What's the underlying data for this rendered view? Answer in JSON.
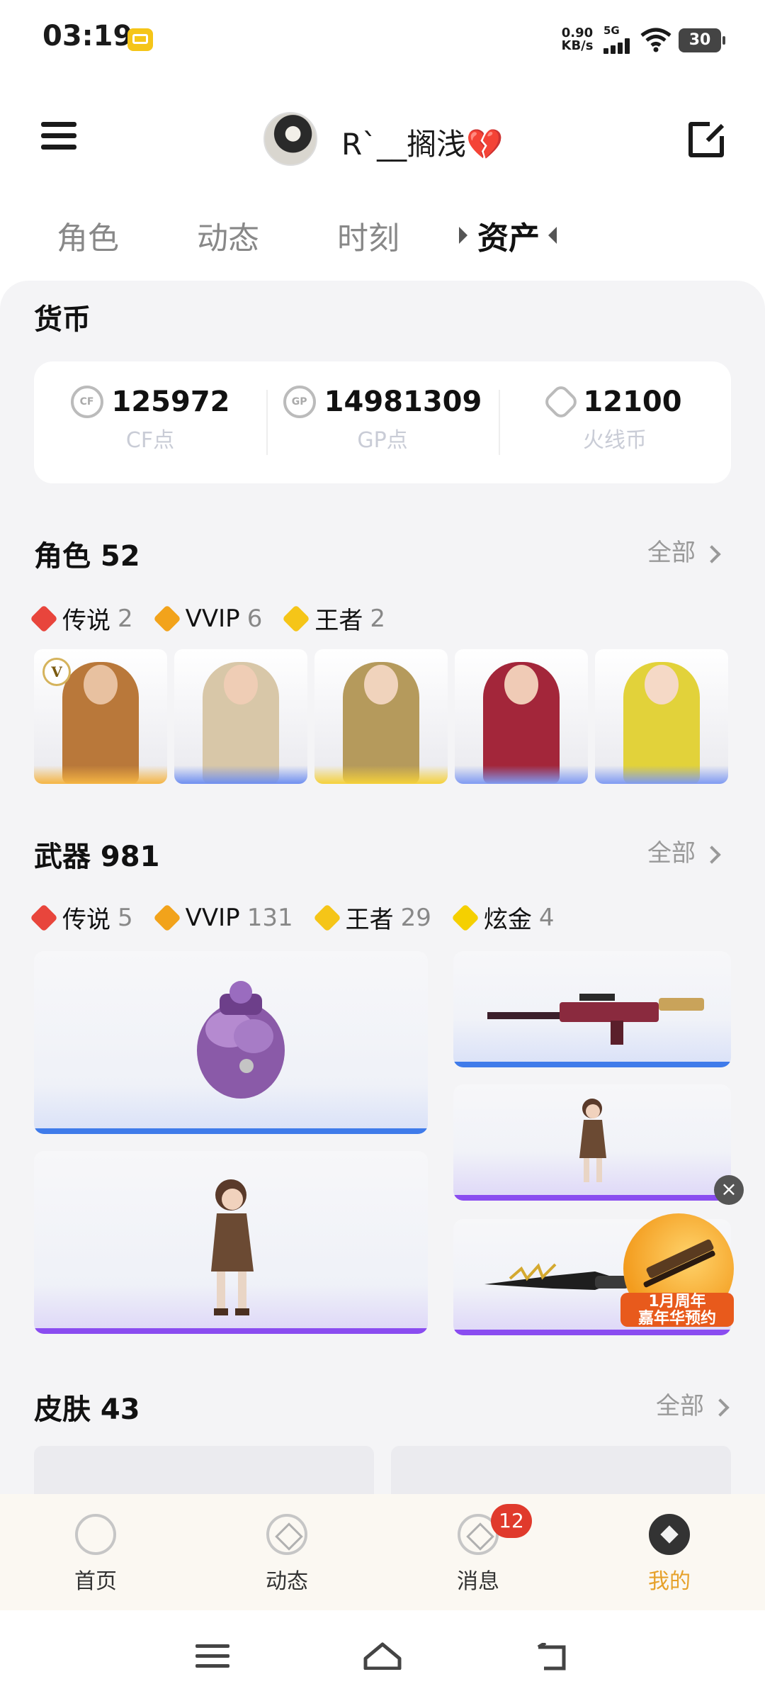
{
  "status_bar": {
    "time": "03:19",
    "net_speed_value": "0.90",
    "net_speed_unit": "KB/s",
    "network": "5G",
    "battery": "30"
  },
  "header": {
    "username": "R`__搁浅",
    "username_emoji": "💔"
  },
  "tabs": [
    {
      "label": "角色"
    },
    {
      "label": "动态"
    },
    {
      "label": "时刻"
    },
    {
      "label": "资产",
      "active": true
    }
  ],
  "currency": {
    "title": "货币",
    "items": [
      {
        "value": "125972",
        "label": "CF点",
        "icon": "cf-point-icon"
      },
      {
        "value": "14981309",
        "label": "GP点",
        "icon_text": "GP"
      },
      {
        "value": "12100",
        "label": "火线币",
        "icon": "huoxian-coin-icon"
      }
    ]
  },
  "characters": {
    "title": "角色 52",
    "more": "全部",
    "tiers": [
      {
        "name": "传说",
        "count": "2",
        "color": "#e8453c"
      },
      {
        "name": "VVIP",
        "count": "6",
        "color": "#f2a31b"
      },
      {
        "name": "王者",
        "count": "2",
        "color": "#f5c518"
      }
    ],
    "v_badge": "V"
  },
  "weapons": {
    "title": "武器 981",
    "more": "全部",
    "tiers": [
      {
        "name": "传说",
        "count": "5",
        "color": "#e8453c"
      },
      {
        "name": "VVIP",
        "count": "131",
        "color": "#f2a31b"
      },
      {
        "name": "王者",
        "count": "29",
        "color": "#f5c518"
      },
      {
        "name": "炫金",
        "count": "4",
        "color": "#f5d000"
      }
    ]
  },
  "skins": {
    "title": "皮肤 43",
    "more": "全部"
  },
  "ad": {
    "line1": "1月周年",
    "line2": "嘉年华预约",
    "close": "×"
  },
  "bottom_nav": [
    {
      "label": "首页"
    },
    {
      "label": "动态"
    },
    {
      "label": "消息",
      "badge": "12"
    },
    {
      "label": "我的",
      "active": true
    }
  ],
  "colors": {
    "accent": "#e6a12a",
    "blue_bar": "#3f7bea",
    "purple_bar": "#8a4cf0",
    "legend_red": "#e8453c"
  }
}
